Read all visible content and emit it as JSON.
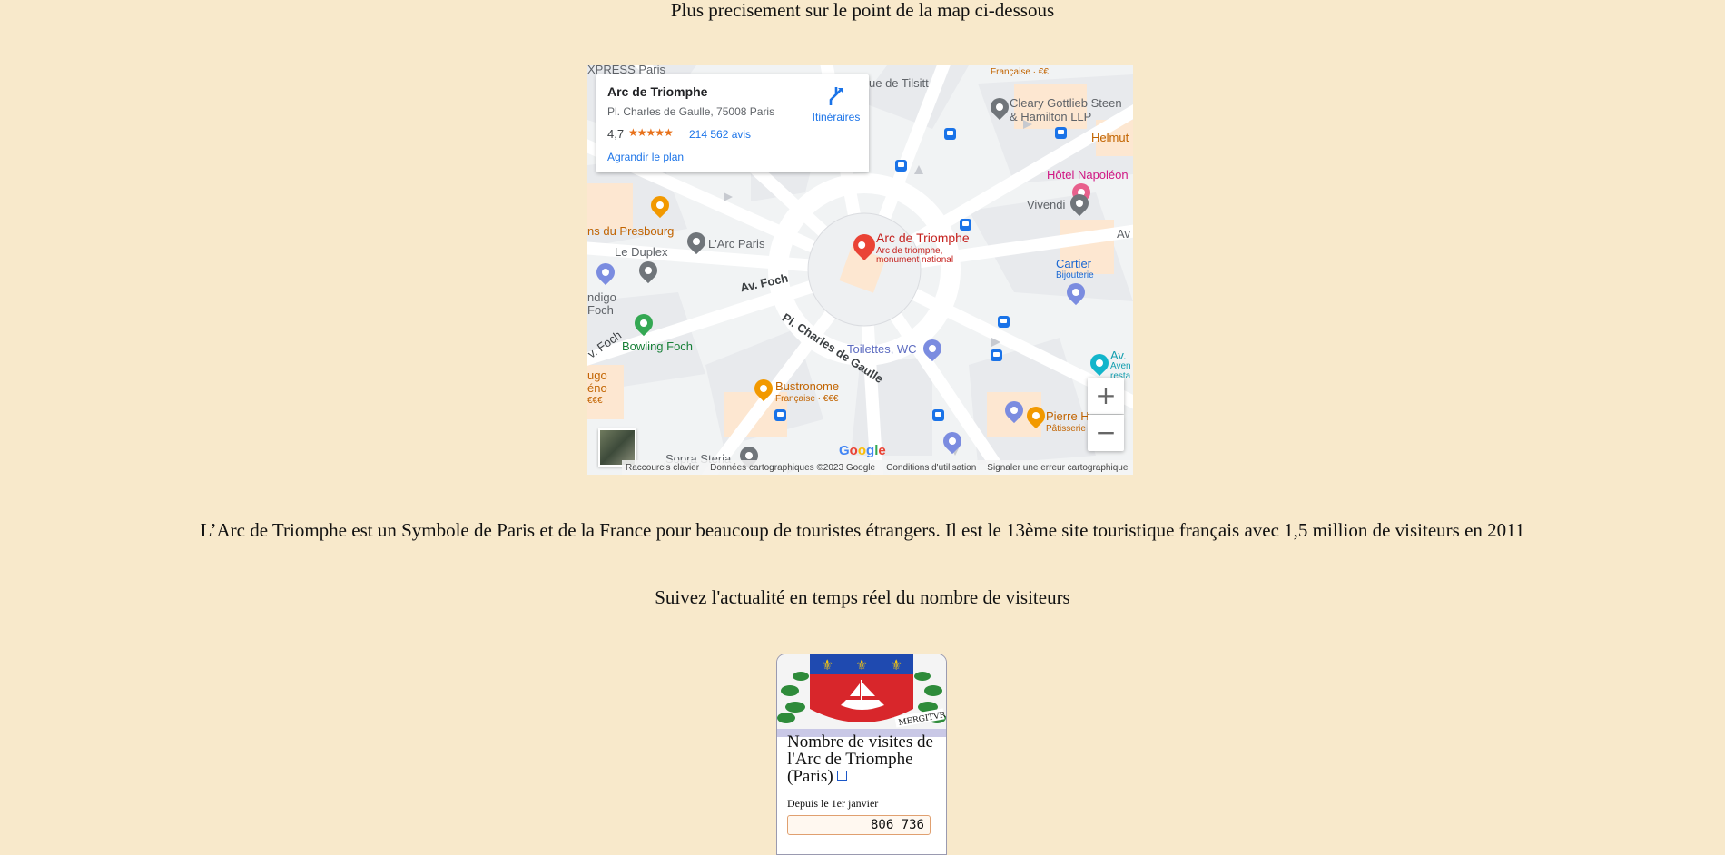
{
  "intro": "Plus precisement sur le point de la map ci-dessous",
  "description": "L’Arc de Triomphe est un Symbole de Paris et de la France pour beaucoup de touristes étrangers. Il est le 13ème site touristique français avec 1,5 million de visiteurs en 2011",
  "follow": "Suivez l'actualité en temps réel du nombre de visiteurs",
  "map": {
    "card": {
      "title": "Arc de Triomphe",
      "address": "Pl. Charles de Gaulle, 75008 Paris",
      "rating": "4,7",
      "stars": "★★★★★",
      "reviews": "214 562 avis",
      "enlarge": "Agrandir le plan",
      "directions": "Itinéraires"
    },
    "pois": {
      "express": "XPRESS Paris",
      "francaise_top": "Française · €€",
      "tilsitt": "ue de Tilsitt",
      "cleary1": "Cleary Gottlieb Steen",
      "cleary2": "& Hamilton LLP",
      "helmut": "Helmut",
      "hotel": "Hôtel Napoléon",
      "vivendi": "Vivendi",
      "presbourg": "ns du Presbourg",
      "arc_paris": "L'Arc Paris",
      "duplex": "Le Duplex",
      "arc_main": "Arc de Triomphe",
      "arc_sub1": "Arc de triomphe,",
      "arc_sub2": "monument national",
      "av_right": "Av",
      "cartier": "Cartier",
      "cartier_sub": "Bijouterie",
      "indigo1": "ndigo",
      "indigo2": "Foch",
      "av_foch": "Av. Foch",
      "charles": "Pl. Charles de Gaulle",
      "bowling": "Bowling Foch",
      "foch_left": "v. Foch",
      "toilettes": "Toilettes, WC",
      "av_right2": "Av.",
      "avenue": "Aven",
      "resta": "resta",
      "hugo": "ugo",
      "geno": "éno",
      "euros": "€€€",
      "bustronome": "Bustronome",
      "bustronome_sub": "Française · €€€",
      "pierre": "Pierre H",
      "patisserie": "Pâtisserie",
      "sopra": "Sopra Steria"
    },
    "zoom_in": "+",
    "zoom_out": "−",
    "footer": {
      "shortcuts": "Raccourcis clavier",
      "data": "Données cartographiques ©2023 Google",
      "terms": "Conditions d'utilisation",
      "report": "Signaler une erreur cartographique"
    }
  },
  "widget": {
    "title": "Nombre de visites de l'Arc de Triomphe (Paris)",
    "since": "Depuis le 1er janvier",
    "count": "806 736",
    "motto": "MERGITVR"
  }
}
